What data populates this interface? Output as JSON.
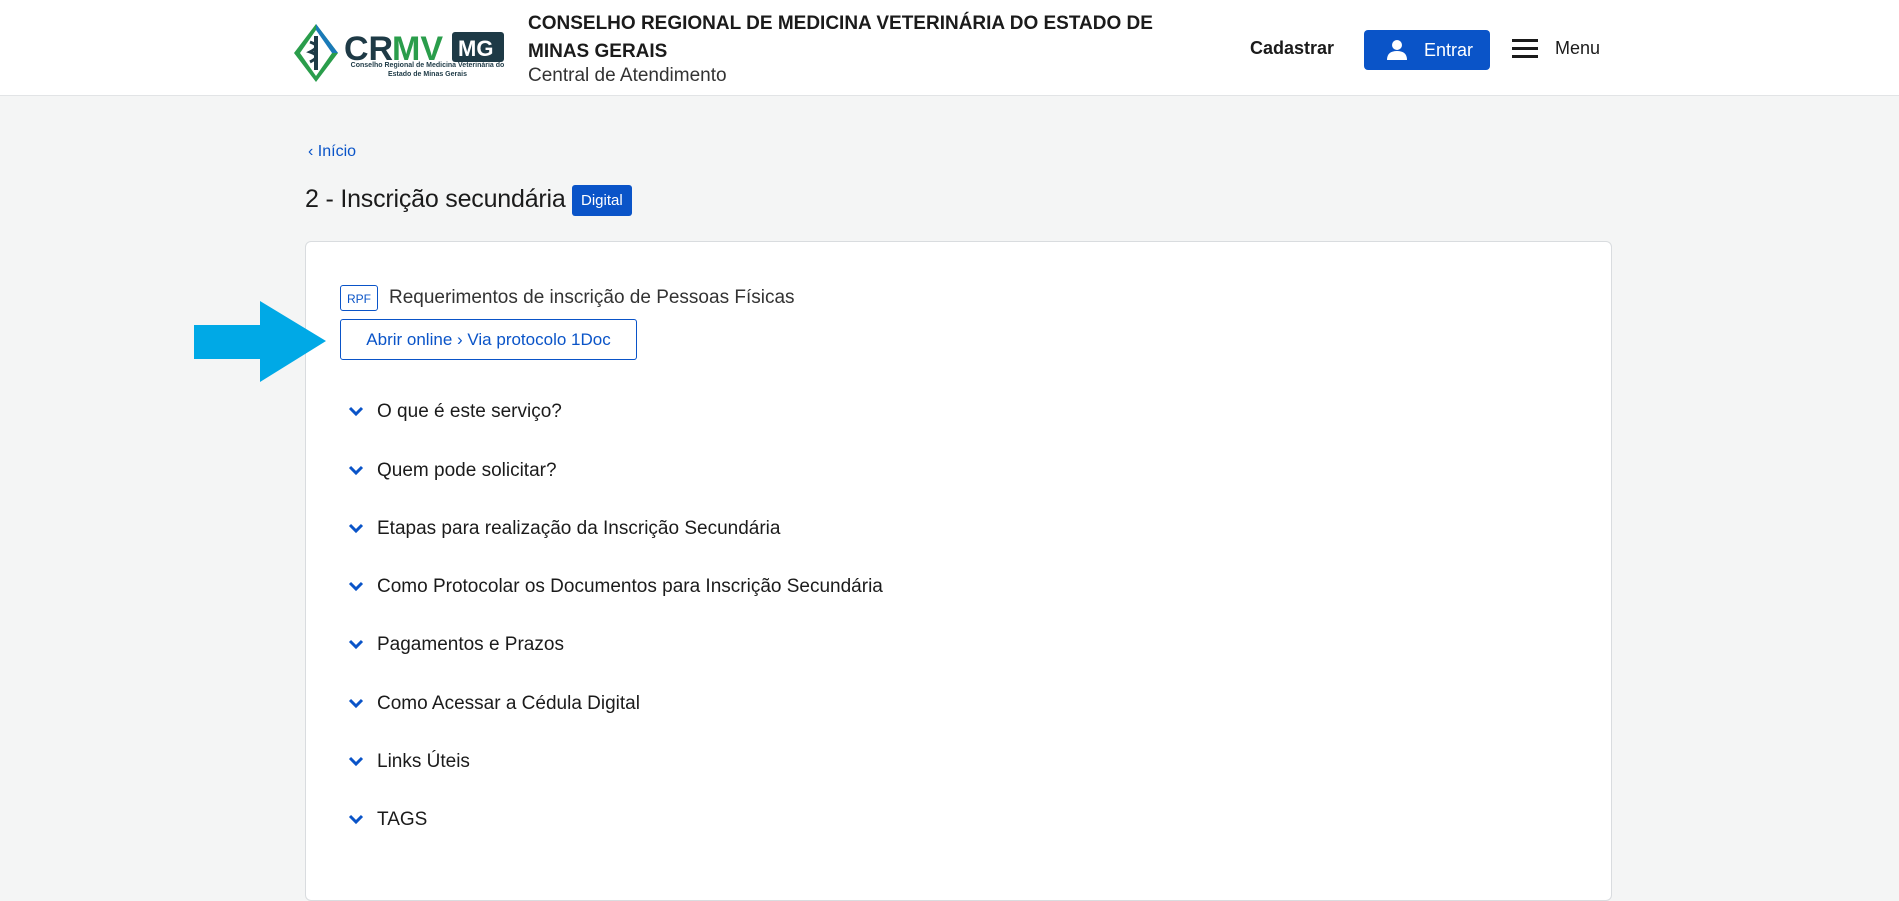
{
  "header": {
    "logo_text": "CRMV",
    "logo_tag": "MG",
    "logo_subtitle": "Conselho Regional de Medicina Veterinária do Estado de Minas Gerais",
    "org_title": "CONSELHO REGIONAL DE MEDICINA VETERINÁRIA DO ESTADO DE MINAS GERAIS",
    "org_subtitle": "Central de Atendimento",
    "cadastrar_label": "Cadastrar",
    "entrar_label": "Entrar",
    "menu_label": "Menu"
  },
  "breadcrumb": {
    "label": "Início"
  },
  "page": {
    "title": "2 - Inscrição secundária",
    "badge": "Digital"
  },
  "service": {
    "tag": "RPF",
    "title": "Requerimentos de inscrição de Pessoas Físicas",
    "open_button": "Abrir online › Via protocolo 1Doc"
  },
  "accordion": [
    {
      "label": "O que é este serviço?"
    },
    {
      "label": "Quem pode solicitar?"
    },
    {
      "label": "Etapas para realização da Inscrição Secundária"
    },
    {
      "label": "Como Protocolar os Documentos para Inscrição Secundária"
    },
    {
      "label": "Pagamentos e Prazos"
    },
    {
      "label": "Como Acessar a Cédula Digital"
    },
    {
      "label": "Links Úteis"
    },
    {
      "label": "TAGS"
    }
  ],
  "colors": {
    "primary": "#0a54c8",
    "arrow": "#00a9e6",
    "logo_green": "#2a9d4b",
    "logo_dark": "#1e3a46"
  }
}
